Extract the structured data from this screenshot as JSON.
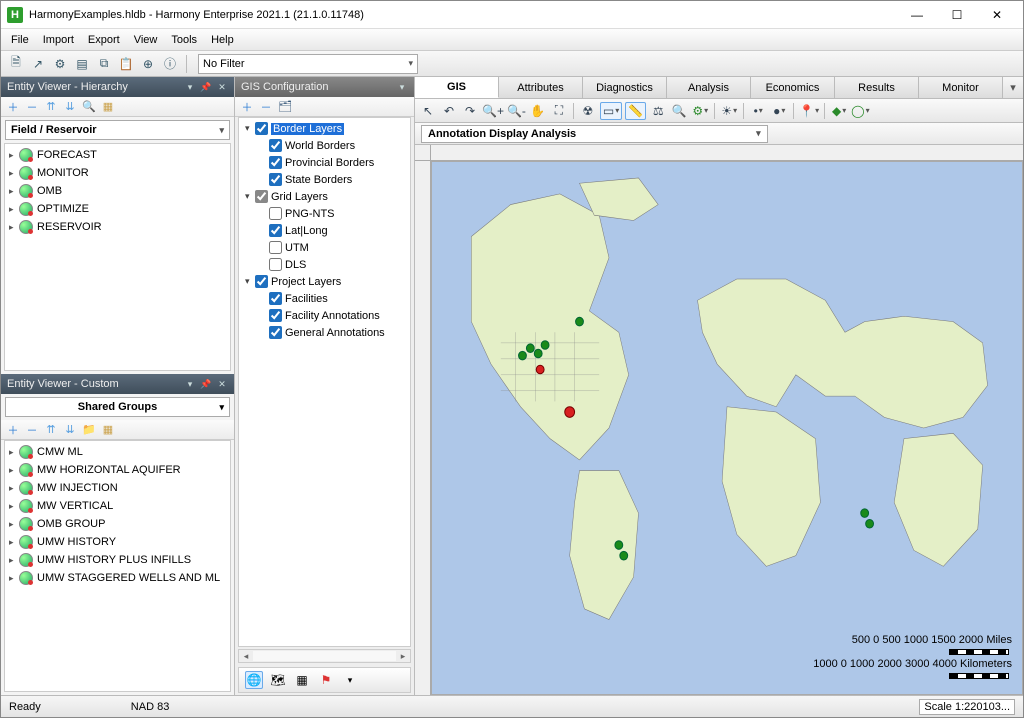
{
  "window": {
    "title": "HarmonyExamples.hldb - Harmony Enterprise 2021.1  (21.1.0.11748)",
    "app_icon_letter": "H"
  },
  "menu": [
    "File",
    "Import",
    "Export",
    "View",
    "Tools",
    "Help"
  ],
  "filter": {
    "label": "No Filter"
  },
  "panels": {
    "hierarchy": {
      "title": "Entity Viewer - Hierarchy",
      "dropdown": "Field / Reservoir",
      "items": [
        "FORECAST",
        "MONITOR",
        "OMB",
        "OPTIMIZE",
        "RESERVOIR"
      ]
    },
    "custom": {
      "title": "Entity Viewer - Custom",
      "dropdown": "Shared Groups",
      "items": [
        "CMW ML",
        "MW HORIZONTAL AQUIFER",
        "MW INJECTION",
        "MW VERTICAL",
        "OMB GROUP",
        "UMW HISTORY",
        "UMW HISTORY PLUS INFILLS",
        "UMW STAGGERED WELLS AND ML"
      ]
    }
  },
  "gis": {
    "title": "GIS Configuration",
    "groups": [
      {
        "name": "Border Layers",
        "checked": true,
        "selected": true,
        "children": [
          {
            "name": "World Borders",
            "checked": true
          },
          {
            "name": "Provincial Borders",
            "checked": true
          },
          {
            "name": "State Borders",
            "checked": true
          }
        ]
      },
      {
        "name": "Grid Layers",
        "checked": "mixed",
        "children": [
          {
            "name": "PNG-NTS",
            "checked": false
          },
          {
            "name": "Lat|Long",
            "checked": true
          },
          {
            "name": "UTM",
            "checked": false
          },
          {
            "name": "DLS",
            "checked": false
          }
        ]
      },
      {
        "name": "Project Layers",
        "checked": true,
        "children": [
          {
            "name": "Facilities",
            "checked": true
          },
          {
            "name": "Facility Annotations",
            "checked": true
          },
          {
            "name": "General Annotations",
            "checked": true
          }
        ]
      }
    ]
  },
  "tabs": [
    "GIS",
    "Attributes",
    "Diagnostics",
    "Analysis",
    "Economics",
    "Results",
    "Monitor"
  ],
  "active_tab": 0,
  "annotation_dd": "Annotation Display Analysis",
  "status": {
    "left": "Ready",
    "mid": "NAD 83",
    "right": "Scale 1:220103..."
  },
  "scale": {
    "line1": "500 0 500 1000 1500 2000 Miles",
    "line2": "1000  0 1000 2000 3000 4000 Kilometers"
  }
}
